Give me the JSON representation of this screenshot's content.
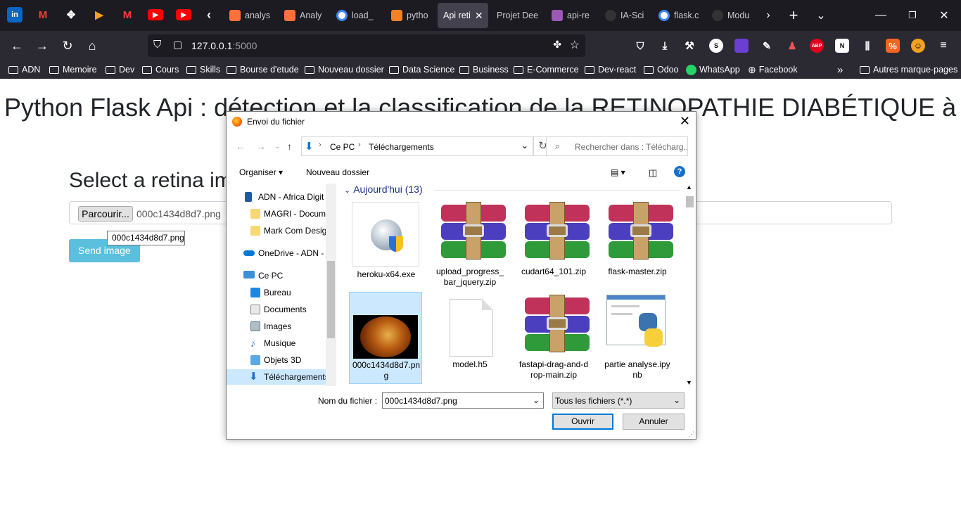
{
  "browser": {
    "tabs": [
      {
        "label": "analys",
        "icon": "document-icon",
        "color": "#ff7139"
      },
      {
        "label": "Analy",
        "icon": "document-icon",
        "color": "#ff7139"
      },
      {
        "label": "load_",
        "icon": "google-icon",
        "color": "#4285f4"
      },
      {
        "label": "pytho",
        "icon": "stackoverflow-icon",
        "color": "#f48024"
      },
      {
        "label": "Api reti",
        "icon": "none",
        "color": "#42414d",
        "active": true
      },
      {
        "label": "Projet Dee",
        "icon": "none",
        "color": "#1c1b22"
      },
      {
        "label": "api-re",
        "icon": "kaggle-icon",
        "color": "#9b59b6"
      },
      {
        "label": "IA-Sci",
        "icon": "github-icon",
        "color": "#333"
      },
      {
        "label": "flask.c",
        "icon": "google-icon",
        "color": "#4285f4"
      },
      {
        "label": "Modu",
        "icon": "github-icon",
        "color": "#333"
      }
    ],
    "url": {
      "host": "127.0.0.1",
      "port": ":5000"
    },
    "bookmarks": [
      "ADN",
      "Memoire",
      "Dev",
      "Cours",
      "Skills",
      "Bourse d'etude",
      "Nouveau dossier",
      "Data Science",
      "Business",
      "E-Commerce",
      "Dev-react",
      "Odoo",
      "WhatsApp",
      "Facebook"
    ],
    "other_bookmarks": "Autres marque-pages",
    "ext_labels": {
      "s": "S",
      "abp": "ABP",
      "notion": "N"
    }
  },
  "page": {
    "title": "Python Flask Api : détection et la classification de la RETINOPATHIE DIABÉTIQUE à",
    "select_heading": "Select a retina im",
    "browse_button": "Parcourir...",
    "chosen_file": "000c1434d8d7.png",
    "tooltip": "000c1434d8d7.png",
    "send_button": "Send image"
  },
  "dialog": {
    "title": "Envoi du fichier",
    "breadcrumb": [
      "Ce PC",
      "Téléchargements"
    ],
    "search_placeholder": "Rechercher dans : Télécharg...",
    "organize": "Organiser",
    "new_folder": "Nouveau dossier",
    "tree": [
      {
        "label": "ADN - Africa Digit",
        "icon": "building-icon"
      },
      {
        "label": "MAGRI - Docum",
        "icon": "folder-icon"
      },
      {
        "label": "Mark Com Desig",
        "icon": "folder-icon"
      },
      {
        "label": "OneDrive - ADN -",
        "icon": "cloud-icon"
      },
      {
        "label": "Ce PC",
        "icon": "computer-icon"
      },
      {
        "label": "Bureau",
        "icon": "desktop-icon"
      },
      {
        "label": "Documents",
        "icon": "documents-icon"
      },
      {
        "label": "Images",
        "icon": "images-icon"
      },
      {
        "label": "Musique",
        "icon": "music-icon"
      },
      {
        "label": "Objets 3D",
        "icon": "cube-icon"
      },
      {
        "label": "Téléchargements",
        "icon": "download-icon",
        "selected": true
      }
    ],
    "group_label": "Aujourd'hui (13)",
    "files": [
      {
        "label": "heroku-x64.exe",
        "type": "exe"
      },
      {
        "label": "upload_progress_bar_jquery.zip",
        "type": "zip"
      },
      {
        "label": "cudart64_101.zip",
        "type": "zip"
      },
      {
        "label": "flask-master.zip",
        "type": "zip"
      },
      {
        "label": "000c1434d8d7.png",
        "type": "image",
        "selected": true
      },
      {
        "label": "model.h5",
        "type": "blank"
      },
      {
        "label": "fastapi-drag-and-drop-main.zip",
        "type": "zip"
      },
      {
        "label": "partie analyse.ipynb",
        "type": "python"
      }
    ],
    "filename_label": "Nom du fichier :",
    "filename_value": "000c1434d8d7.png",
    "filter": "Tous les fichiers (*.*)",
    "open_button": "Ouvrir",
    "cancel_button": "Annuler"
  }
}
